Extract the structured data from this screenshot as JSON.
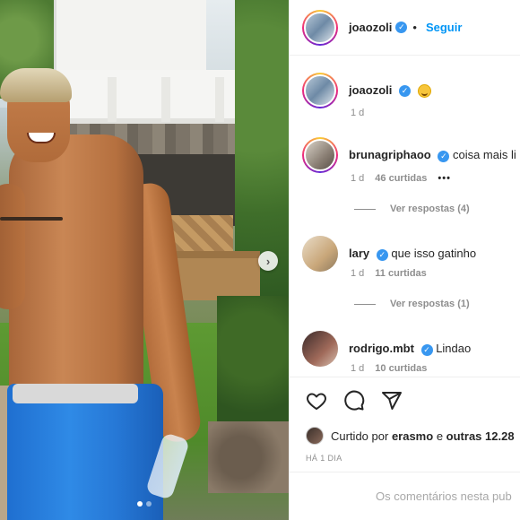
{
  "post": {
    "author": "joaozoli",
    "follow_label": "Seguir",
    "separator": "•",
    "caption_time": "1 d"
  },
  "comments": [
    {
      "username": "bruna**griphaoo**",
      "display_user": "brunagriphaoo",
      "text": "coisa mais li",
      "time": "1 d",
      "likes": "46 curtidas",
      "replies": "Ver respostas (4)"
    },
    {
      "display_user": "lary",
      "text": "que isso gatinho",
      "time": "1 d",
      "likes": "11 curtidas",
      "replies": "Ver respostas (1)"
    },
    {
      "display_user": "rodrigo.mbt",
      "text": "Lindao",
      "time": "1 d",
      "likes": "10 curtidas"
    }
  ],
  "liked_by": {
    "prefix": "Curtido por",
    "user": "erasmo",
    "suffix": "e",
    "others": "outras 12.28"
  },
  "date_label": "HÁ 1 DIA",
  "comment_placeholder": "Os comentários nesta pub",
  "more_options": "•••",
  "carousel": {
    "count": 2,
    "active": 0
  },
  "icons": [
    "heart-icon",
    "comment-icon",
    "share-icon",
    "verified-badge-icon",
    "chevron-right-icon"
  ],
  "colors": {
    "verified": "#3897f0",
    "follow": "#0095f6",
    "meta": "#8e8e8e"
  }
}
